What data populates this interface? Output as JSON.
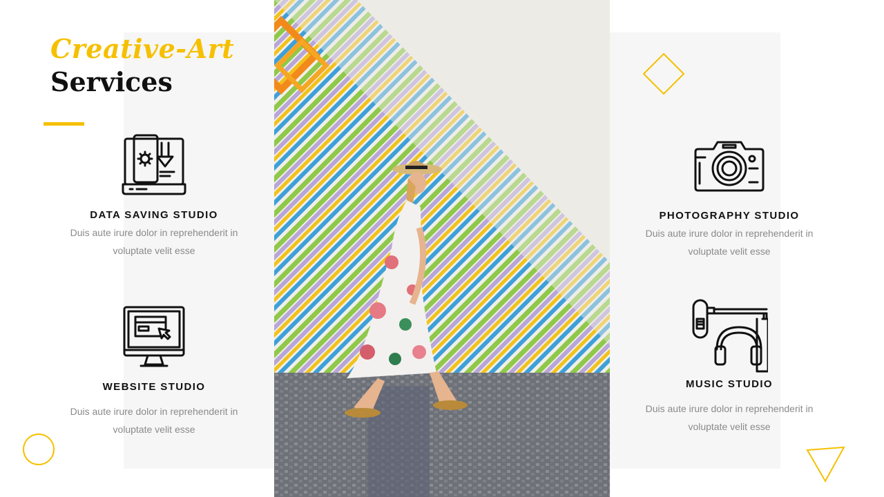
{
  "header": {
    "title_accent": "Creative-Art",
    "title_main": "Services"
  },
  "colors": {
    "accent": "#f5c000",
    "panel": "#f6f6f6",
    "text_dark": "#111111",
    "text_muted": "#8a8a8a"
  },
  "services": [
    {
      "title": "DATA SAVING STUDIO",
      "description": "Duis aute irure dolor in reprehenderit in voluptate velit esse",
      "icon": "laptop-settings-download-icon"
    },
    {
      "title": "WEBSITE STUDIO",
      "description": "Duis aute irure dolor in reprehenderit in voluptate velit esse",
      "icon": "monitor-cursor-icon"
    },
    {
      "title": "PHOTOGRAPHY STUDIO",
      "description": "Duis aute irure dolor in reprehenderit in voluptate velit esse",
      "icon": "camera-icon"
    },
    {
      "title": "MUSIC STUDIO",
      "description": "Duis aute irure dolor in reprehenderit in voluptate velit esse",
      "icon": "microphone-headphones-icon"
    }
  ],
  "decorations": [
    "diamond-outline",
    "circle-outline",
    "triangle-outline"
  ]
}
